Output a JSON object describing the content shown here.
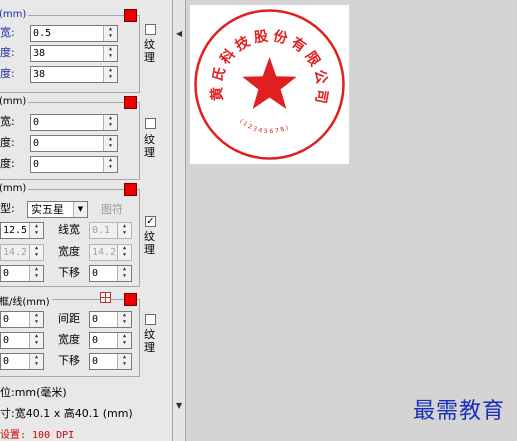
{
  "colors": {
    "stamp_red": "#e02020",
    "swatch_red": "#ee0000",
    "watermark_blue": "#1a2fb8",
    "label_blue": "#1a2aa0"
  },
  "group1": {
    "title": "(mm)",
    "rows": [
      {
        "label": "宽:",
        "value": "0.5"
      },
      {
        "label": "度:",
        "value": "38"
      },
      {
        "label": "度:",
        "value": "38"
      }
    ],
    "texture_label": "纹理",
    "texture_checked": false
  },
  "group2": {
    "title": "(mm)",
    "rows": [
      {
        "label": "宽:",
        "value": "0"
      },
      {
        "label": "度:",
        "value": "0"
      },
      {
        "label": "度:",
        "value": "0"
      }
    ],
    "texture_label": "纹理",
    "texture_checked": false
  },
  "group3": {
    "title": "(mm)",
    "type_label": "型:",
    "type_value": "实五星",
    "symbol_label": "图符",
    "size_value": "12.5",
    "line_width_label": "线宽",
    "line_width_value": "0.1",
    "height_value": "14.2",
    "width_label": "宽度",
    "width_value": "14.2",
    "offset_value": "0",
    "down_label": "下移",
    "down_value": "0",
    "texture_label": "纹理",
    "texture_checked": true,
    "texture_check_mark": "✓"
  },
  "group4": {
    "title": "框/线(mm)",
    "rows": [
      {
        "value": "0",
        "label": "间距",
        "value2": "0"
      },
      {
        "value": "0",
        "label": "宽度",
        "value2": "0"
      },
      {
        "value": "0",
        "label": "下移",
        "value2": "0"
      }
    ],
    "texture_label": "纹理",
    "texture_checked": false
  },
  "info": {
    "unit": "位:mm(毫米)",
    "size": "寸:宽40.1 x 高40.1 (mm)",
    "dpi": "设置: 100 DPI"
  },
  "stamp": {
    "arc_text": "黄氏科技股份有限公司",
    "bottom_code": "( 1 2 3 4 5 6 7 8 )"
  },
  "splitter": {
    "arrow_left": "◀",
    "arrow_down": "▼"
  },
  "watermark": "最需教育"
}
